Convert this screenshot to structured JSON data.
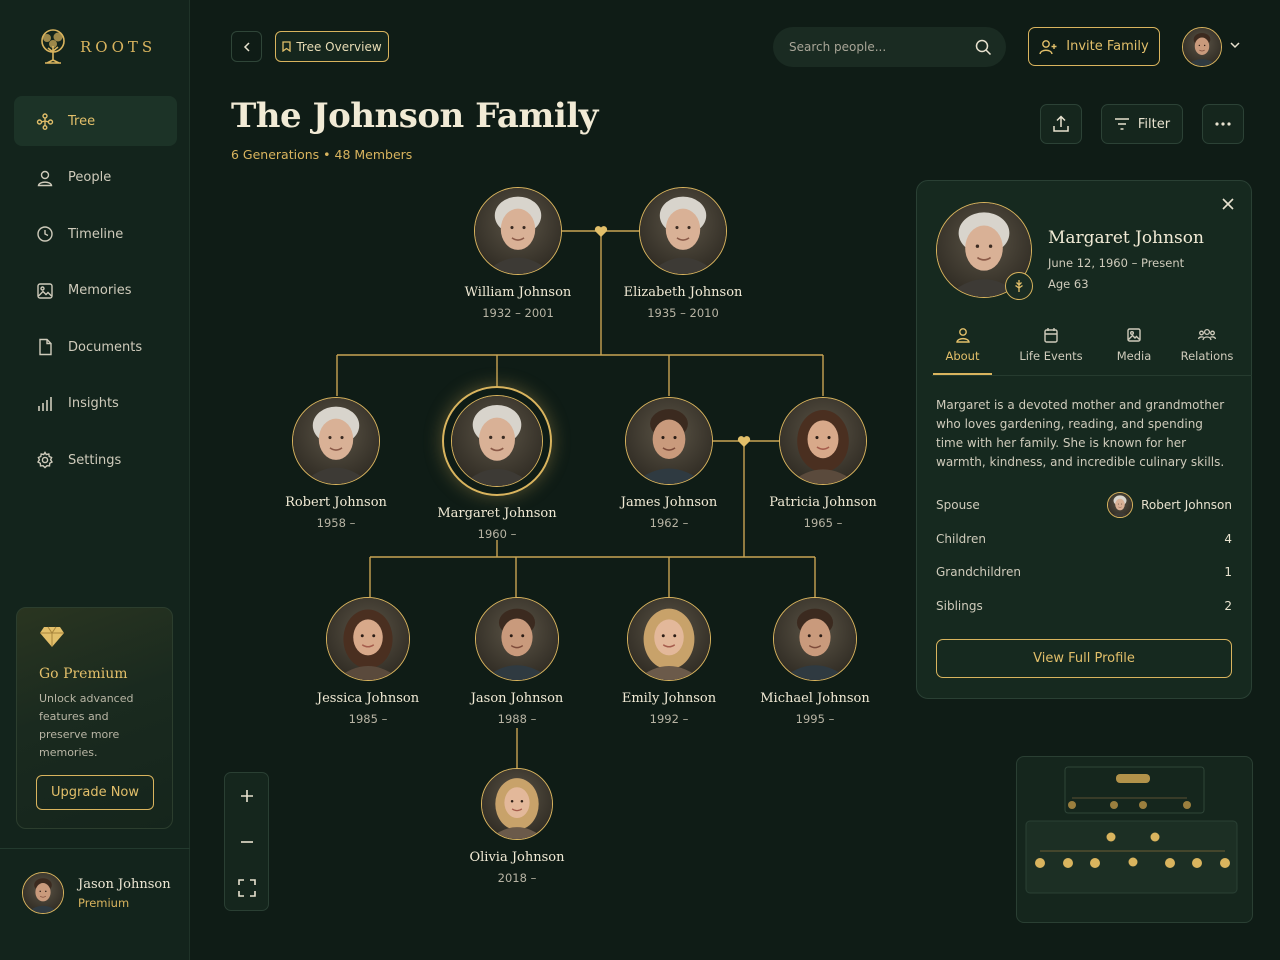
{
  "app": {
    "name": "ROOTS"
  },
  "sidebar": {
    "items": [
      {
        "label": "Tree",
        "icon": "tree-icon",
        "active": true
      },
      {
        "label": "People",
        "icon": "user-icon"
      },
      {
        "label": "Timeline",
        "icon": "clock-icon"
      },
      {
        "label": "Memories",
        "icon": "image-icon"
      },
      {
        "label": "Documents",
        "icon": "document-icon"
      },
      {
        "label": "Insights",
        "icon": "bar-chart-icon"
      },
      {
        "label": "Settings",
        "icon": "gear-icon"
      }
    ],
    "premium": {
      "title": "Go Premium",
      "description": "Unlock advanced features and preserve more memories.",
      "button": "Upgrade Now"
    },
    "user": {
      "name": "Jason Johnson",
      "plan": "Premium"
    }
  },
  "header": {
    "breadcrumb": "Tree Overview",
    "search_placeholder": "Search people...",
    "invite_label": "Invite Family"
  },
  "page": {
    "title": "The Johnson Family",
    "subtitle": "6 Generations • 48 Members",
    "filter_label": "Filter"
  },
  "tree": {
    "people": [
      {
        "name": "William Johnson",
        "years": "1932 – 2001"
      },
      {
        "name": "Elizabeth Johnson",
        "years": "1935 – 2010"
      },
      {
        "name": "Robert Johnson",
        "years": "1958 –"
      },
      {
        "name": "Margaret Johnson",
        "years": "1960 –",
        "selected": true
      },
      {
        "name": "James Johnson",
        "years": "1962 –"
      },
      {
        "name": "Patricia Johnson",
        "years": "1965 –"
      },
      {
        "name": "Jessica Johnson",
        "years": "1985 –"
      },
      {
        "name": "Jason Johnson",
        "years": "1988 –"
      },
      {
        "name": "Emily Johnson",
        "years": "1992 –"
      },
      {
        "name": "Michael Johnson",
        "years": "1995 –"
      },
      {
        "name": "Olivia Johnson",
        "years": "2018 –"
      }
    ]
  },
  "profile": {
    "name": "Margaret Johnson",
    "dates": "June 12, 1960 – Present",
    "age": "Age 63",
    "tabs": [
      {
        "label": "About",
        "active": true
      },
      {
        "label": "Life Events"
      },
      {
        "label": "Media"
      },
      {
        "label": "Relations"
      }
    ],
    "bio": "Margaret is a devoted mother and grandmother who loves gardening, reading, and spending time with her family. She is known for her warmth, kindness, and incredible culinary skills.",
    "stats": {
      "spouse_label": "Spouse",
      "spouse_value": "Robert Johnson",
      "children_label": "Children",
      "children_value": "4",
      "grandchildren_label": "Grandchildren",
      "grandchildren_value": "1",
      "siblings_label": "Siblings",
      "siblings_value": "2"
    },
    "button": "View Full Profile"
  },
  "colors": {
    "background": "#0f1c16",
    "sidebar": "#13241c",
    "accent": "#d9b45e",
    "panel": "#16291f"
  }
}
